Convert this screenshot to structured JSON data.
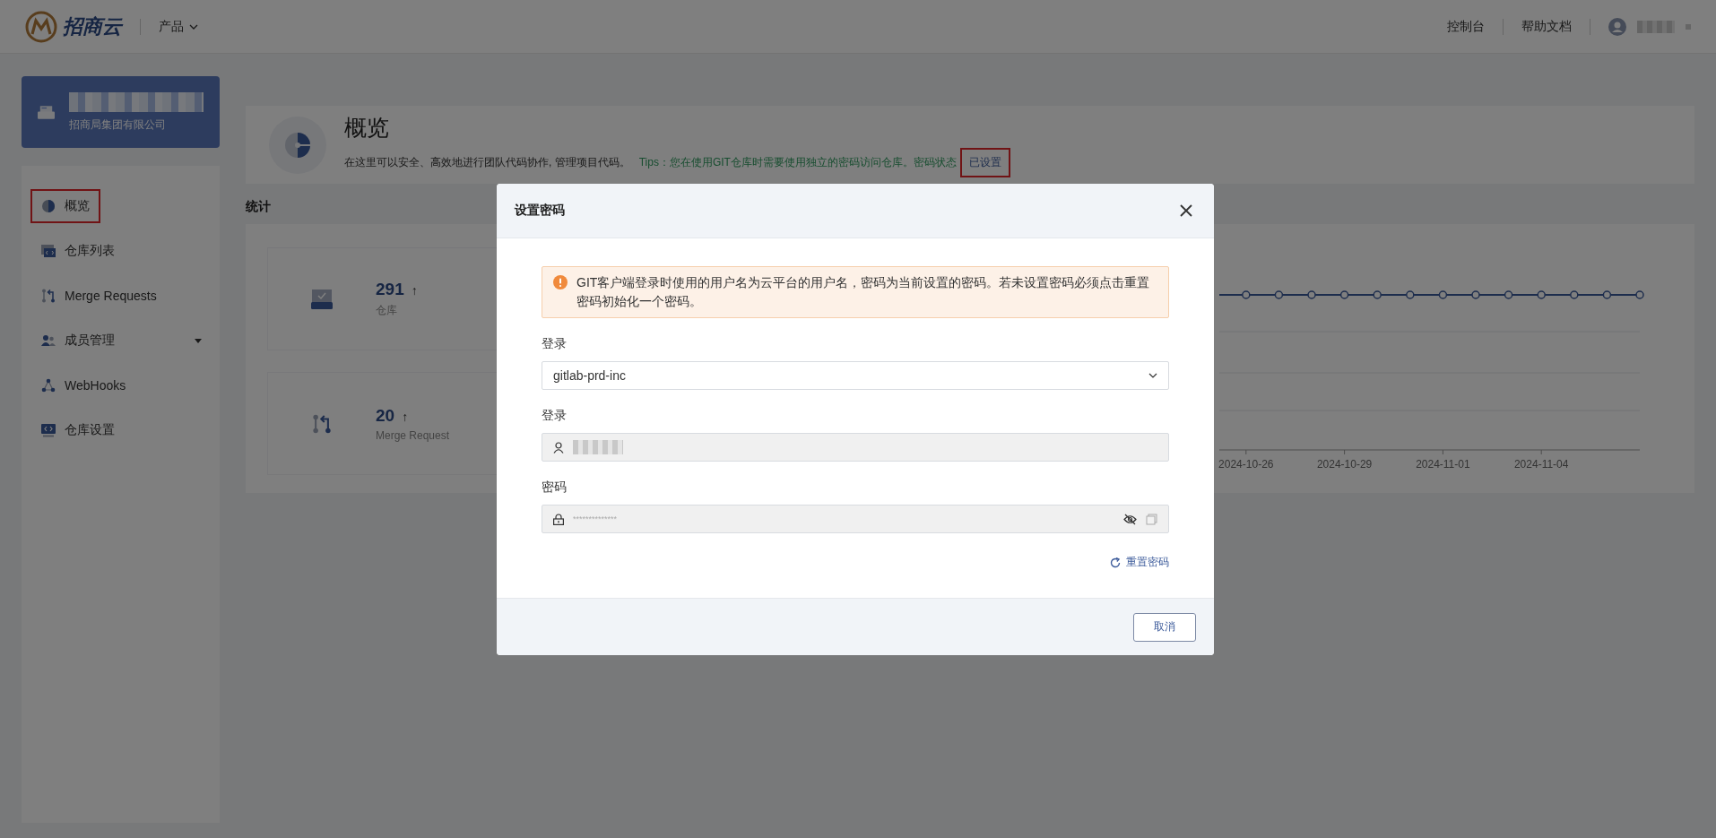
{
  "header": {
    "logo_text": "招商云",
    "product_menu": "产品",
    "links": [
      "控制台",
      "帮助文档"
    ]
  },
  "sidebar": {
    "org": {
      "company": "招商局集团有限公司"
    },
    "items": [
      {
        "label": "概览",
        "highlighted": true,
        "expandable": false
      },
      {
        "label": "仓库列表",
        "highlighted": false,
        "expandable": false
      },
      {
        "label": "Merge Requests",
        "highlighted": false,
        "expandable": false
      },
      {
        "label": "成员管理",
        "highlighted": false,
        "expandable": true
      },
      {
        "label": "WebHooks",
        "highlighted": false,
        "expandable": false
      },
      {
        "label": "仓库设置",
        "highlighted": false,
        "expandable": false
      }
    ]
  },
  "overview": {
    "title": "概览",
    "description": "在这里可以安全、高效地进行团队代码协作, 管理项目代码。",
    "tips": "Tips：您在使用GIT仓库时需要使用独立的密码访问仓库。密码状态",
    "password_status": {
      "text": "已设置",
      "highlighted": true
    }
  },
  "stats": {
    "title": "统计",
    "cards": [
      {
        "value": "291",
        "trend": "↑",
        "label": "仓库"
      },
      {
        "value": "20",
        "trend": "↑",
        "label": "Merge Request"
      }
    ],
    "chart": {
      "x_labels": [
        "2024-10-26",
        "2024-10-29",
        "2024-11-01",
        "2024-11-04"
      ]
    }
  },
  "dialog": {
    "title": "设置密码",
    "alert": "GIT客户端登录时使用的用户名为云平台的用户名，密码为当前设置的密码。若未设置密码必须点击重置密码初始化一个密码。",
    "fields": [
      {
        "kind": "select",
        "label": "登录",
        "value": "gitlab-prd-inc",
        "disabled": false
      },
      {
        "kind": "user",
        "label": "登录",
        "disabled": true
      },
      {
        "kind": "password",
        "label": "密码",
        "placeholder": "**************",
        "disabled": true
      }
    ],
    "reset_link": "重置密码",
    "cancel_button": "取消"
  }
}
